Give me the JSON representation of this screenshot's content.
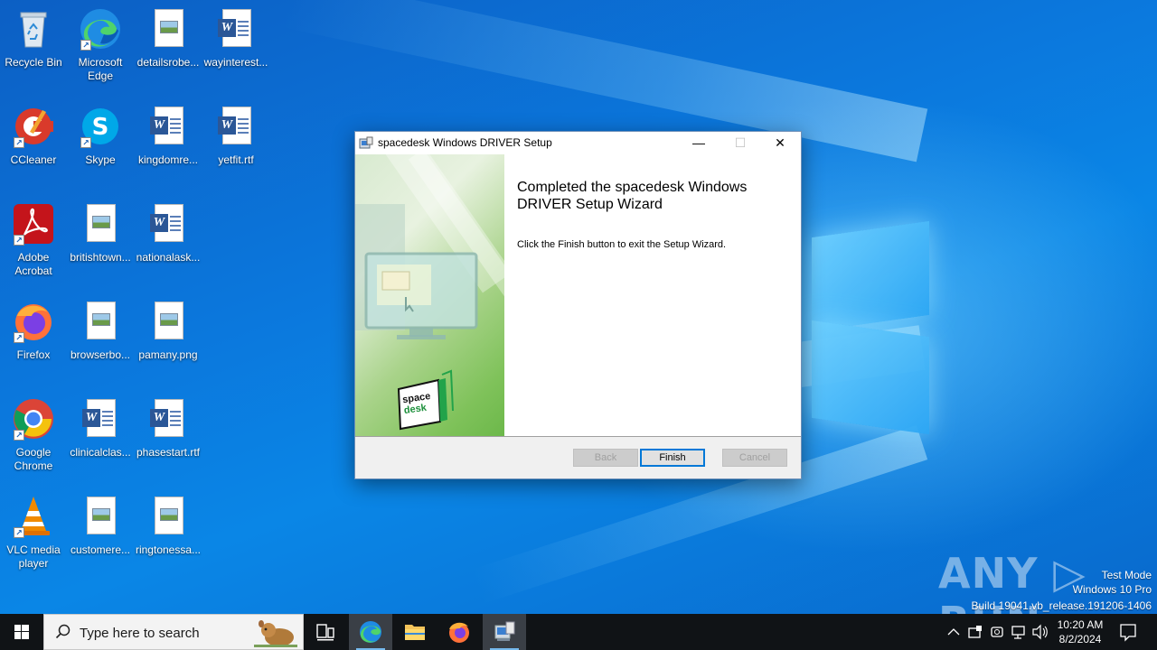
{
  "desktop": {
    "icons": [
      {
        "label": "Recycle Bin"
      },
      {
        "label": "Microsoft Edge"
      },
      {
        "label": "detailsrobe..."
      },
      {
        "label": "wayinterest..."
      },
      {
        "label": "CCleaner"
      },
      {
        "label": "Skype"
      },
      {
        "label": "kingdomre..."
      },
      {
        "label": "yetfit.rtf"
      },
      {
        "label": "Adobe Acrobat"
      },
      {
        "label": "britishtown..."
      },
      {
        "label": "nationalask..."
      },
      {
        "label": "Firefox"
      },
      {
        "label": "browserbo..."
      },
      {
        "label": "pamany.png"
      },
      {
        "label": "Google Chrome"
      },
      {
        "label": "clinicalclas..."
      },
      {
        "label": "phasestart.rtf"
      },
      {
        "label": "VLC media player"
      },
      {
        "label": "customere..."
      },
      {
        "label": "ringtonessa..."
      }
    ]
  },
  "dialog": {
    "title": "spacedesk Windows DRIVER Setup",
    "heading": "Completed the spacedesk Windows DRIVER Setup Wizard",
    "body": "Click the Finish button to exit the Setup Wizard.",
    "banner_logo_top": "space",
    "banner_logo_bottom": "desk",
    "buttons": {
      "back": "Back",
      "finish": "Finish",
      "cancel": "Cancel"
    },
    "controls": {
      "minimize": "—",
      "maximize": "☐",
      "close": "✕"
    }
  },
  "watermark": {
    "logo": "ANY ▷ RUN",
    "mode": "Test Mode",
    "edition": "Windows 10 Pro",
    "build": "Build 19041.vb_release.191206-1406"
  },
  "taskbar": {
    "search_placeholder": "Type here to search",
    "time": "10:20 AM",
    "date": "8/2/2024"
  },
  "colors": {
    "accent": "#0078d7",
    "taskbar": "#101316",
    "desktop": "#0a78dc"
  }
}
